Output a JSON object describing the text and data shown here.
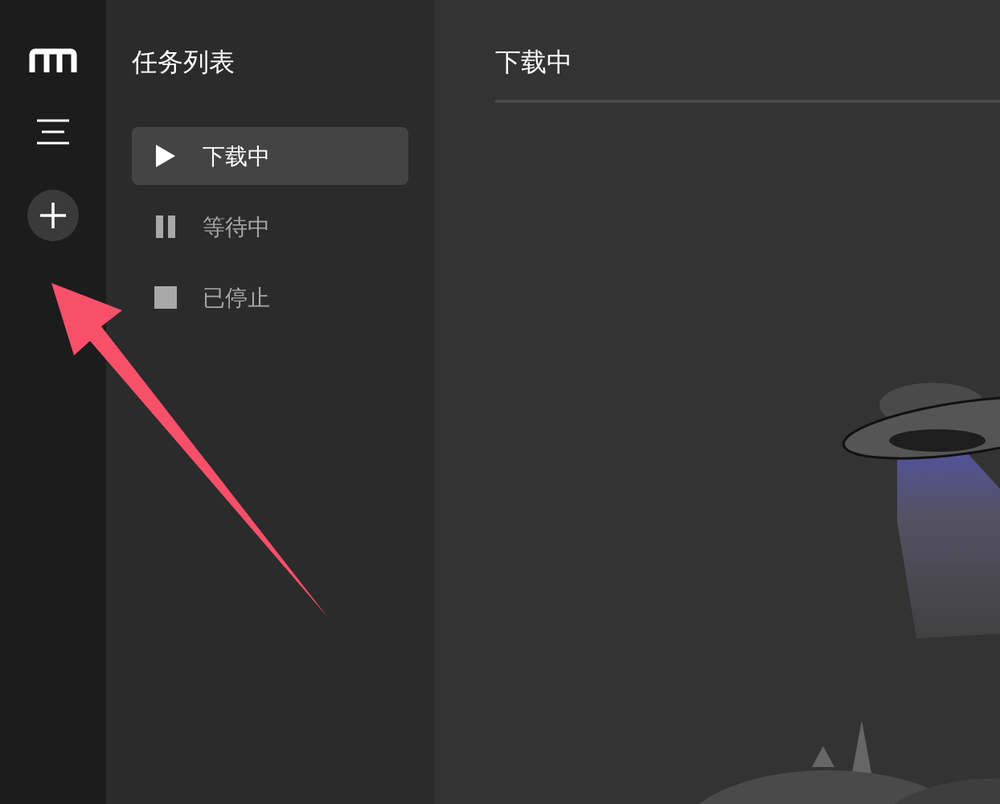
{
  "sidebar": {
    "title": "任务列表",
    "items": [
      {
        "kind": "play",
        "label": "下载中",
        "selected": true
      },
      {
        "kind": "pause",
        "label": "等待中",
        "selected": false
      },
      {
        "kind": "stop",
        "label": "已停止",
        "selected": false
      }
    ]
  },
  "main": {
    "title": "下载中"
  }
}
